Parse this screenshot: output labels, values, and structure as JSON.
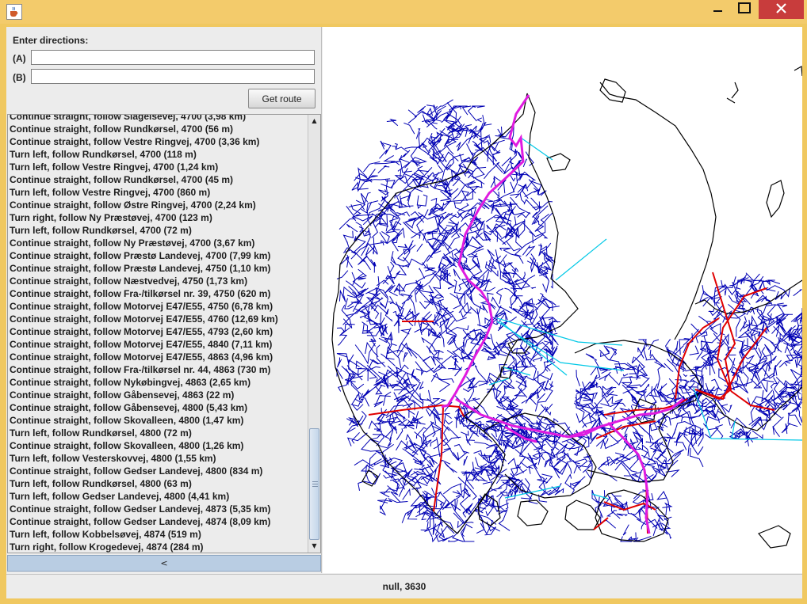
{
  "window": {
    "app_icon": "java-cup-icon",
    "minimize_glyph": "—",
    "maximize_glyph": "☐",
    "close_glyph": "✕"
  },
  "form": {
    "heading": "Enter directions:",
    "label_a": "(A)",
    "label_b": "(B)",
    "value_a": "",
    "value_b": "",
    "get_route_label": "Get route"
  },
  "directions": [
    "Continue straight, follow Slagelsevej, 4700 (3,98 km)",
    "Continue straight, follow Rundkørsel, 4700 (56 m)",
    "Continue straight, follow Vestre Ringvej, 4700 (3,36 km)",
    "Turn left, follow Rundkørsel, 4700 (118 m)",
    "Turn left, follow Vestre Ringvej, 4700 (1,24 km)",
    "Continue straight, follow Rundkørsel, 4700 (45 m)",
    "Turn left, follow Vestre Ringvej, 4700 (860 m)",
    "Continue straight, follow Østre Ringvej, 4700 (2,24 km)",
    "Turn right, follow Ny Præstøvej, 4700 (123 m)",
    "Turn left, follow Rundkørsel, 4700 (72 m)",
    "Continue straight, follow Ny Præstøvej, 4700 (3,67 km)",
    "Continue straight, follow Præstø Landevej, 4700 (7,99 km)",
    "Continue straight, follow Præstø Landevej, 4750 (1,10 km)",
    "Continue straight, follow Næstvedvej, 4750 (1,73 km)",
    "Continue straight, follow Fra-/tilkørsel nr. 39, 4750 (620 m)",
    "Continue straight, follow Motorvej E47/E55, 4750 (6,78 km)",
    "Continue straight, follow Motorvej E47/E55, 4760 (12,69 km)",
    "Continue straight, follow Motorvej E47/E55, 4793 (2,60 km)",
    "Continue straight, follow Motorvej E47/E55, 4840 (7,11 km)",
    "Continue straight, follow Motorvej E47/E55, 4863 (4,96 km)",
    "Continue straight, follow Fra-/tilkørsel nr. 44, 4863 (730 m)",
    "Continue straight, follow Nykøbingvej, 4863 (2,65 km)",
    "Continue straight, follow Gåbensevej, 4863 (22 m)",
    "Continue straight, follow Gåbensevej, 4800 (5,43 km)",
    "Continue straight, follow Skovalleen, 4800 (1,47 km)",
    "Turn left, follow Rundkørsel, 4800 (72 m)",
    "Continue straight, follow Skovalleen, 4800 (1,26 km)",
    "Turn left, follow Vesterskovvej, 4800 (1,55 km)",
    "Continue straight, follow Gedser Landevej, 4800 (834 m)",
    "Turn left, follow Rundkørsel, 4800 (63 m)",
    "Turn left, follow Gedser Landevej, 4800 (4,41 km)",
    "Continue straight, follow Gedser Landevej, 4873 (5,35 km)",
    "Continue straight, follow Gedser Landevej, 4874 (8,09 km)",
    "Turn left, follow Kobbelsøvej, 4874 (519 m)",
    "Turn right, follow Krogedevej, 4874 (284 m)"
  ],
  "list_scrollbar": {
    "up_arrow": "▲",
    "down_arrow": "▼",
    "position": 0.72
  },
  "collapse_label": "<",
  "map": {
    "colors": {
      "coastline": "#000000",
      "roads": "#0000b4",
      "main_roads": "#e00000",
      "motorways": "#e01be0",
      "ferries": "#00c8e6"
    }
  },
  "status": "null, 3630"
}
